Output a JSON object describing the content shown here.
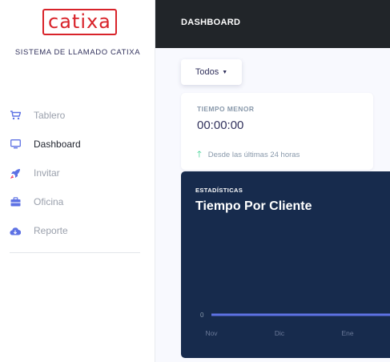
{
  "brand": {
    "logo_text": "catixa",
    "subtitle": "SISTEMA DE LLAMADO CATIXA"
  },
  "sidebar": {
    "items": [
      {
        "label": "Tablero",
        "icon": "cart-icon",
        "active": false
      },
      {
        "label": "Dashboard",
        "icon": "monitor-icon",
        "active": true
      },
      {
        "label": "Invitar",
        "icon": "rocket-icon",
        "active": false
      },
      {
        "label": "Oficina",
        "icon": "briefcase-icon",
        "active": false
      },
      {
        "label": "Reporte",
        "icon": "cloud-download-icon",
        "active": false
      }
    ]
  },
  "header": {
    "title": "DASHBOARD"
  },
  "filter": {
    "selected": "Todos"
  },
  "stat_card": {
    "title": "TIEMPO MENOR",
    "value": "00:00:00",
    "footnote": "Desde las últimas 24 horas"
  },
  "chart_card": {
    "overline": "ESTADÍSTICAS",
    "title": "Tiempo Por Cliente"
  },
  "chart_data": {
    "type": "line",
    "title": "Tiempo Por Cliente",
    "categories": [
      "Nov",
      "Dic",
      "Ene"
    ],
    "y_tick_labels": [
      "0"
    ],
    "series": [
      {
        "values": [
          0,
          0,
          0
        ],
        "color": "#5e72e4"
      }
    ]
  },
  "colors": {
    "sidebar_bg": "#ffffff",
    "topbar_bg": "#212529",
    "chart_bg": "#172b4d",
    "line": "#5e72e4",
    "positive": "#2dce89",
    "logo": "#d8232a"
  }
}
